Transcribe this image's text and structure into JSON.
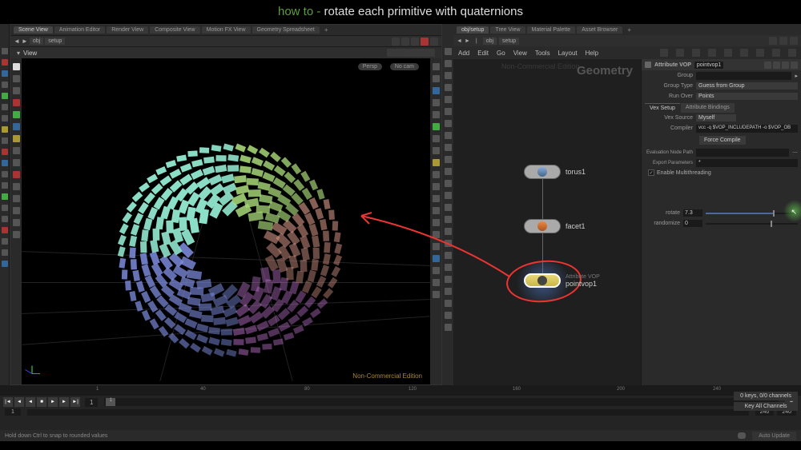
{
  "title": {
    "prefix": "how to - ",
    "main": "rotate each primitive with quaternions"
  },
  "left_tabs": [
    "Scene View",
    "Animation Editor",
    "Render View",
    "Composite View",
    "Motion FX View",
    "Geometry Spreadsheet"
  ],
  "viewport": {
    "path": [
      "obj",
      "setup"
    ],
    "view_label": "View",
    "persp": "Persp",
    "nocam": "No cam",
    "nce": "Non-Commercial Edition"
  },
  "network": {
    "tabs": [
      "obj/setup",
      "Tree View",
      "Material Palette",
      "Asset Browser"
    ],
    "path": [
      "obj",
      "setup"
    ],
    "menu": [
      "Add",
      "Edit",
      "Go",
      "View",
      "Tools",
      "Layout",
      "Help"
    ],
    "geom_label": "Geometry",
    "nce_faded": "Non-Commercial Edition",
    "nodes": {
      "torus": "torus1",
      "facet": "facet1",
      "vop_type": "Attribute VOP",
      "pointvop": "pointvop1"
    }
  },
  "params": {
    "header_type": "Attribute VOP",
    "header_name": "pointvop1",
    "group_label": "Group",
    "group_type_label": "Group Type",
    "group_type_value": "Guess from Group",
    "run_over_label": "Run Over",
    "run_over_value": "Points",
    "tab1": "Vex Setup",
    "tab2": "Attribute Bindings",
    "vex_source_label": "Vex Source",
    "vex_source_value": "Myself",
    "compiler_label": "Compiler",
    "compiler_value": "vcc -q $VOP_INCLUDEPATH -o $VOP_OB",
    "force_compile": "Force Compile",
    "eval_path_label": "Evaluation Node Path",
    "export_params_label": "Export Parameters",
    "export_params_value": "*",
    "multithread": "Enable Multithreading",
    "rotate_label": "rotate",
    "rotate_value": "7.3",
    "randomize_label": "randomize",
    "randomize_value": "0"
  },
  "playback": {
    "frame": "1",
    "start": "1",
    "end_range": "240",
    "end_display": "240"
  },
  "timeline_ticks": [
    "1",
    "40",
    "80",
    "120",
    "160",
    "200",
    "240"
  ],
  "status": {
    "hint": "Hold down Ctrl to snap to rounded values",
    "keys": "0 keys, 0/0 channels",
    "key_all": "Key All Channels",
    "auto_update": "Auto Update"
  }
}
